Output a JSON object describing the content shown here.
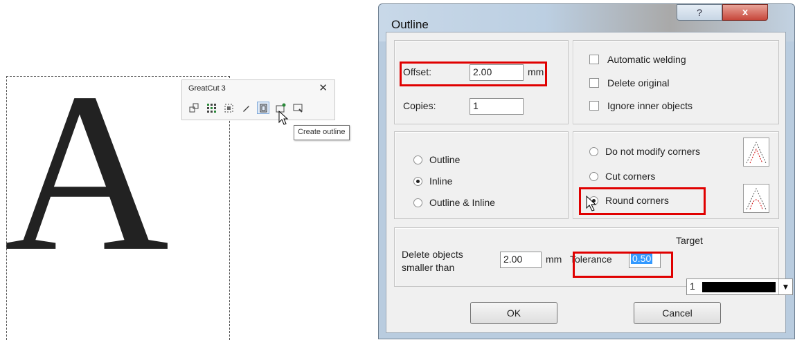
{
  "canvas": {
    "letter": "A"
  },
  "toolbar": {
    "title": "GreatCut 3",
    "close": "✕",
    "icons": [
      "group-icon",
      "grid-icon",
      "select-icon",
      "pen-icon",
      "create-outline-icon",
      "import-icon",
      "export-icon"
    ],
    "tooltip": "Create outline"
  },
  "dialog": {
    "title": "Outline",
    "help": "?",
    "close": "x",
    "offset_label": "Offset:",
    "offset_value": "2.00",
    "offset_unit": "mm",
    "copies_label": "Copies:",
    "copies_value": "1",
    "automatic_welding": "Automatic welding",
    "delete_original": "Delete original",
    "ignore_inner": "Ignore inner objects",
    "mode_options": [
      "Outline",
      "Inline",
      "Outline & Inline"
    ],
    "mode_selected": "Inline",
    "corner_options": [
      "Do not modify corners",
      "Cut corners",
      "Round corners"
    ],
    "corner_selected": "Round corners",
    "delete_objects_label_line1": "Delete objects",
    "delete_objects_label_line2": "smaller than",
    "delete_objects_value": "2.00",
    "delete_objects_unit": "mm",
    "tolerance_label": "Tolerance",
    "tolerance_value": "0.50",
    "target_label": "Target",
    "target_value": "1",
    "target_color": "#000000",
    "ok": "OK",
    "cancel": "Cancel",
    "highlight_color": "#e00000"
  }
}
